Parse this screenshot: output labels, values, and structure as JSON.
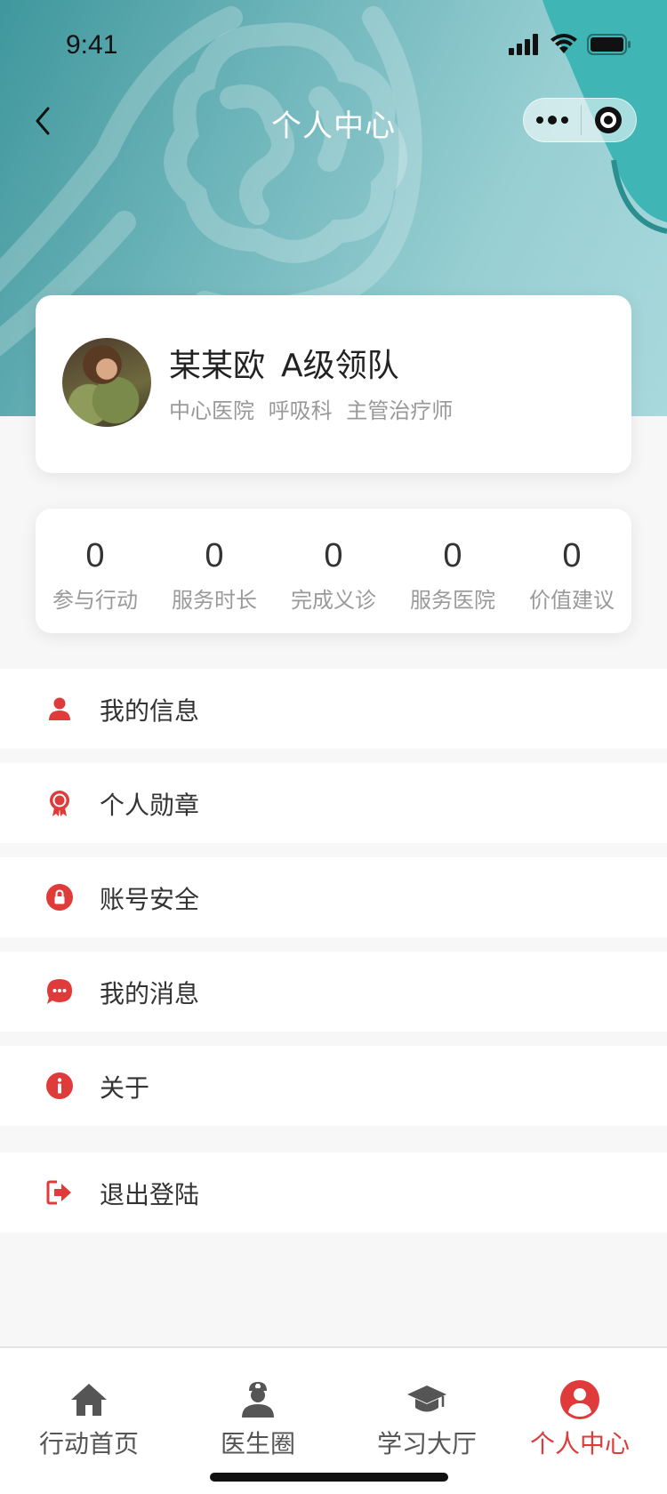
{
  "status_bar": {
    "time": "9:41"
  },
  "nav": {
    "title": "个人中心"
  },
  "profile": {
    "name": "某某欧",
    "level": "A级领队",
    "hospital": "中心医院",
    "department": "呼吸科",
    "title": "主管治疗师"
  },
  "stats": [
    {
      "value": "0",
      "label": "参与行动"
    },
    {
      "value": "0",
      "label": "服务时长"
    },
    {
      "value": "0",
      "label": "完成义诊"
    },
    {
      "value": "0",
      "label": "服务医院"
    },
    {
      "value": "0",
      "label": "价值建议"
    }
  ],
  "menu": [
    {
      "label": "我的信息",
      "icon": "person-icon"
    },
    {
      "label": "个人勋章",
      "icon": "medal-icon"
    },
    {
      "label": "账号安全",
      "icon": "lock-icon"
    },
    {
      "label": "我的消息",
      "icon": "message-icon"
    },
    {
      "label": "关于",
      "icon": "info-icon"
    },
    {
      "label": "退出登陆",
      "icon": "logout-icon"
    }
  ],
  "tabs": [
    {
      "label": "行动首页",
      "icon": "home-icon"
    },
    {
      "label": "医生圈",
      "icon": "doctor-icon"
    },
    {
      "label": "学习大厅",
      "icon": "graduation-cap-icon"
    },
    {
      "label": "个人中心",
      "icon": "user-circle-icon",
      "active": true
    }
  ],
  "colors": {
    "accent": "#e03b3b",
    "header_teal": "#6db5ba",
    "page_background": "#f7f7f7"
  }
}
